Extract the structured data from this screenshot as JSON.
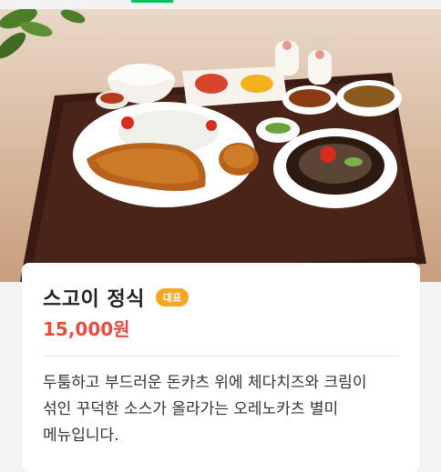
{
  "menu": {
    "name": "스고이 정식",
    "badge": "대표",
    "price": "15,000원",
    "description": "두툼하고 부드러운 돈카츠 위에 체다치즈와 크림이 섞인 꾸덕한 소스가 올라가는 오레노카츠 별미 메뉴입니다."
  },
  "colors": {
    "accent": "#03c75a",
    "price": "#e84c3d",
    "badge": "#f5a623"
  }
}
